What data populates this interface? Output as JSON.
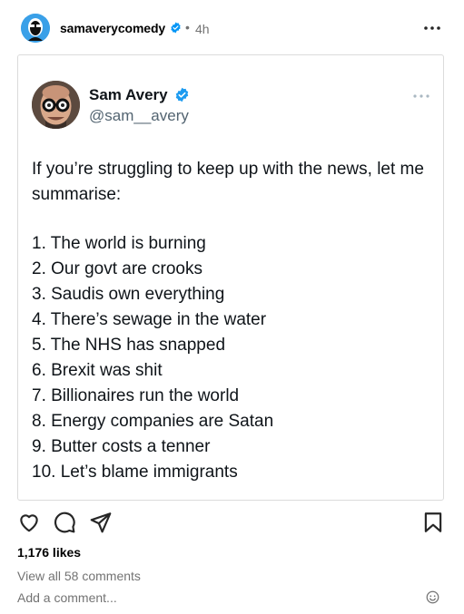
{
  "post": {
    "username": "samaverycomedy",
    "separator": "•",
    "time": "4h"
  },
  "tweet": {
    "name": "Sam Avery",
    "handle": "@sam__avery",
    "intro": "If you’re struggling to keep up with the news, let me summarise:",
    "items": [
      "1. The world is burning",
      "2. Our govt are crooks",
      "3. Saudis own everything",
      "4. There’s sewage in the water",
      "5. The NHS has snapped",
      "6. Brexit was shit",
      "7. Billionaires run the world",
      "8. Energy companies are Satan",
      "9. Butter costs a tenner",
      "10. Let’s blame immigrants"
    ]
  },
  "engagement": {
    "likes": "1,176 likes",
    "comments_link": "View all 58 comments",
    "add_comment_placeholder": "Add a comment..."
  },
  "icons": {
    "verified": "verified-badge-icon",
    "more": "more-horizontal-icon",
    "like": "heart-icon",
    "comment": "comment-bubble-icon",
    "share": "send-paper-plane-icon",
    "save": "bookmark-icon",
    "emoji": "emoji-smile-icon"
  },
  "colors": {
    "verified_blue": "#0095f6",
    "twitter_verified": "#1d9bf0",
    "secondary_text": "#737373",
    "tweet_text": "#0f1419",
    "handle_text": "#536471",
    "card_border": "#dbdbdb"
  }
}
